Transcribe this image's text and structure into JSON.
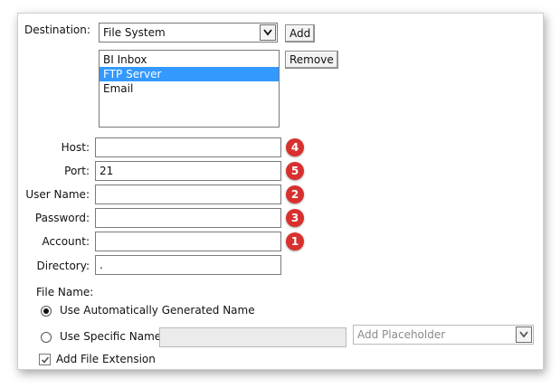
{
  "destination": {
    "label": "Destination:",
    "selected_value": "File System",
    "add_label": "Add",
    "remove_label": "Remove",
    "list_items": [
      {
        "label": "BI Inbox",
        "selected": false
      },
      {
        "label": "FTP Server",
        "selected": true
      },
      {
        "label": "Email",
        "selected": false
      }
    ]
  },
  "fields": {
    "host": {
      "label": "Host:",
      "value": "",
      "badge": "4"
    },
    "port": {
      "label": "Port:",
      "value": "21",
      "badge": "5"
    },
    "user_name": {
      "label": "User Name:",
      "value": "",
      "badge": "2"
    },
    "password": {
      "label": "Password:",
      "value": "",
      "badge": "3"
    },
    "account": {
      "label": "Account:",
      "value": "",
      "badge": "1"
    },
    "directory": {
      "label": "Directory:",
      "value": "."
    }
  },
  "file_name": {
    "label": "File Name:",
    "option_auto": "Use Automatically Generated Name",
    "option_specific": "Use Specific Name",
    "auto_selected": true,
    "specific_value": "",
    "placeholder_select": "Add Placeholder",
    "add_extension_label": "Add File Extension",
    "add_extension_checked": true
  },
  "colors": {
    "badge": "#d8302f",
    "selection": "#3399ff"
  },
  "icons": {
    "dropdown": "chevron-down-icon",
    "check": "check-icon"
  }
}
